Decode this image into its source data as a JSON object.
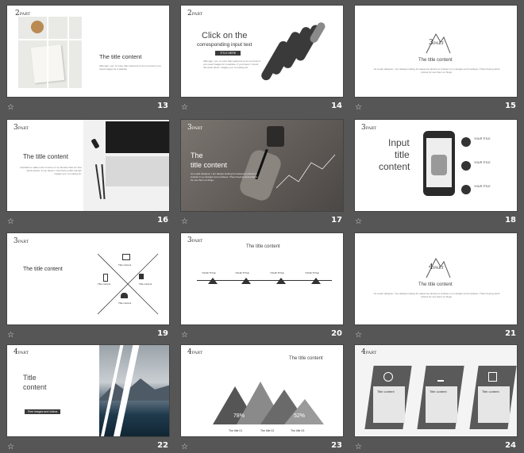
{
  "slides": [
    {
      "num": "13",
      "title": "The title  content",
      "body": "Although, you' re more than welcome to let me know if you need images for a website",
      "part_num": "2",
      "part_word": "PART"
    },
    {
      "num": "14",
      "title": "Click on the",
      "subtitle": "corresponding input text",
      "button": "TITLE HERE",
      "body": "Although, you' re more than welcome to let me know if you need images for a website. If you haven' t found the stock photo. Images you' re looking for.",
      "part_num": "2",
      "part_word": "PART"
    },
    {
      "num": "15",
      "title": "The title content",
      "body": "As a web designer, I am always looking for awesome photos to include in my designs and mockups. There buying stock photos for use them on blogs.",
      "part_num": "3",
      "part_word": "PART"
    },
    {
      "num": "16",
      "title": "The title content",
      "body": "I decided to make a list of some of my favorite sites for free stock photos. If you haven' t found the public domain images you' re looking for.",
      "part_num": "3",
      "part_word": "PART"
    },
    {
      "num": "17",
      "title": "The",
      "title2": "title content",
      "body": "As a web designer, I am always looking for awesome photos to include in my designs and mockups. There buying stock photos for use them on blogs.",
      "part_num": "3",
      "part_word": "PART"
    },
    {
      "num": "18",
      "title1": "Input",
      "title2": "title",
      "title3": "content",
      "items": [
        "YOUR TITLE",
        "YOUR TITLE",
        "YOUR TITLE"
      ],
      "part_num": "3",
      "part_word": "PART"
    },
    {
      "num": "19",
      "title": "The title  content",
      "labels": [
        "Title content",
        "Title content",
        "Title content",
        "Title content"
      ],
      "part_num": "3",
      "part_word": "PART"
    },
    {
      "num": "20",
      "title": "The title content",
      "steps": [
        "YOUR TITLE",
        "YOUR TITLE",
        "YOUR TITLE",
        "YOUR TITLE"
      ],
      "part_num": "3",
      "part_word": "PART"
    },
    {
      "num": "21",
      "title": "The title content",
      "body": "As a web designer, I am always looking for awesome photos to include in my designs and mockups. There buying stock photos for use them on blogs.",
      "part_num": "4",
      "part_word": "PART"
    },
    {
      "num": "22",
      "title1": "Title",
      "title2": "content",
      "button": "Free images and videos",
      "part_num": "4",
      "part_word": "PART"
    },
    {
      "num": "23",
      "title": "The title content",
      "pcts": [
        "78%",
        "52%"
      ],
      "labels": [
        "The title 01",
        "The title 02",
        "The title 03"
      ],
      "part_num": "4",
      "part_word": "PART"
    },
    {
      "num": "24",
      "labels": [
        "Title content",
        "Title content",
        "Title content"
      ],
      "part_num": "4",
      "part_word": "PART"
    }
  ],
  "star_icon": "☆",
  "colors": {
    "background": "#565656",
    "accent": "#3a3a3a"
  }
}
